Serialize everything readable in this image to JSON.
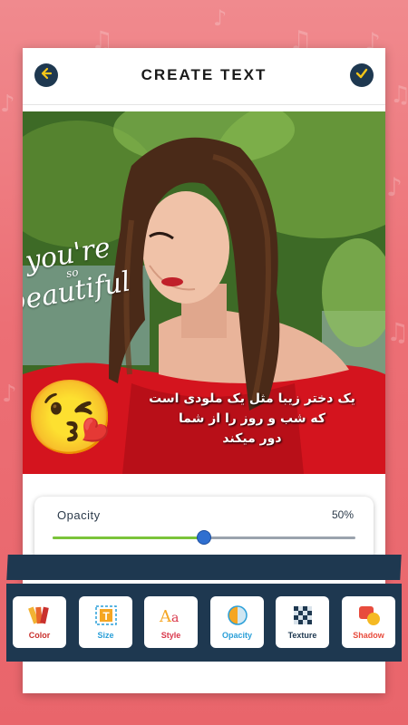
{
  "header": {
    "title": "CREATE TEXT",
    "back_icon": "back-arrow-icon",
    "confirm_icon": "checkmark-icon"
  },
  "photo": {
    "sticker_text_line1": "you're",
    "sticker_text_line2": "so",
    "sticker_text_line3": "beautiful",
    "emoji": "😘",
    "urdu_text_line1": "یک دختر زیبا مثل یک ملودی است",
    "urdu_text_line2": "که شب و روز را از شما",
    "urdu_text_line3": "دور میکند"
  },
  "opacity": {
    "label": "Opacity",
    "value_text": "50%",
    "value": 0.5
  },
  "tools": [
    {
      "label": "Color",
      "icon": "color-palette-icon",
      "color": "#e8652c"
    },
    {
      "label": "Size",
      "icon": "text-size-icon",
      "color": "#2a9fd8"
    },
    {
      "label": "Style",
      "icon": "font-style-icon",
      "color": "#d9364a"
    },
    {
      "label": "Opacity",
      "icon": "opacity-icon",
      "color": "#2a9fd8"
    },
    {
      "label": "Texture",
      "icon": "texture-icon",
      "color": "#1e3850"
    },
    {
      "label": "Shadow",
      "icon": "shadow-icon",
      "color": "#e84c3d"
    }
  ],
  "colors": {
    "accent_green": "#7bc43a",
    "thumb_blue": "#2f6fd0",
    "toolbar": "#1e3850"
  }
}
